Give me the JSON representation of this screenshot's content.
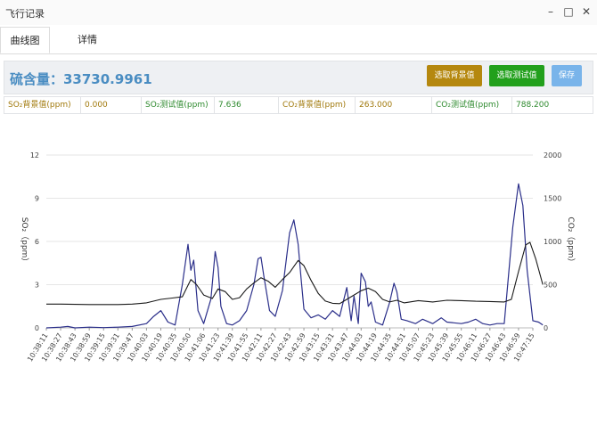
{
  "window": {
    "title": "飞行记录"
  },
  "tabs": [
    {
      "label": "曲线图"
    },
    {
      "label": "详情"
    }
  ],
  "summary": {
    "label": "硫含量：33730.9961"
  },
  "buttons": {
    "select_bg": "选取背景值",
    "select_test": "选取测试值",
    "save": "保存"
  },
  "readings": {
    "so2_bg_label": "SO₂背景值(ppm)",
    "so2_bg_value": "0.000",
    "so2_test_label": "SO₂测试值(ppm)",
    "so2_test_value": "7.636",
    "co2_bg_label": "CO₂背景值(ppm)",
    "co2_bg_value": "263.000",
    "co2_test_label": "CO₂测试值(ppm)",
    "co2_test_value": "788.200"
  },
  "colors": {
    "so2": "#2b2f8a",
    "co2": "#1a1a1a",
    "grid": "#e6e6e6"
  },
  "chart_data": {
    "type": "line",
    "ylabel_left": "SO₂（ppm）",
    "ylabel_right": "CO₂（ppm）",
    "left_ticks": [
      "0",
      "3",
      "6",
      "9",
      "12"
    ],
    "right_ticks": [
      "0",
      "500",
      "1000",
      "1500",
      "2000"
    ],
    "ylim_left": [
      0,
      12
    ],
    "ylim_right": [
      0,
      2000
    ],
    "x_ticks": [
      "10:38:11",
      "10:38:27",
      "10:38:43",
      "10:38:59",
      "10:39:15",
      "10:39:31",
      "10:39:47",
      "10:40:03",
      "10:40:19",
      "10:40:35",
      "10:40:50",
      "10:41:06",
      "10:41:23",
      "10:41:39",
      "10:41:55",
      "10:42:11",
      "10:42:27",
      "10:42:43",
      "10:42:59",
      "10:43:15",
      "10:43:31",
      "10:43:47",
      "10:44:03",
      "10:44:19",
      "10:44:35",
      "10:44:51",
      "10:45:07",
      "10:45:23",
      "10:45:39",
      "10:45:55",
      "10:46:11",
      "10:46:27",
      "10:46:43",
      "10:46:59",
      "10:47:15"
    ],
    "series": [
      {
        "axis": "left",
        "points": [
          [
            0,
            0
          ],
          [
            1,
            0.05
          ],
          [
            1.5,
            0.1
          ],
          [
            2,
            0
          ],
          [
            3,
            0.05
          ],
          [
            4,
            0.02
          ],
          [
            5,
            0.05
          ],
          [
            6,
            0.1
          ],
          [
            7,
            0.3
          ],
          [
            7.5,
            0.8
          ],
          [
            8,
            1.2
          ],
          [
            8.5,
            0.4
          ],
          [
            9,
            0.2
          ],
          [
            9.5,
            3
          ],
          [
            9.9,
            5.8
          ],
          [
            10.1,
            4
          ],
          [
            10.3,
            4.7
          ],
          [
            10.6,
            1.2
          ],
          [
            11,
            0.3
          ],
          [
            11.5,
            2
          ],
          [
            11.8,
            5.3
          ],
          [
            12,
            4.2
          ],
          [
            12.2,
            1.5
          ],
          [
            12.6,
            0.3
          ],
          [
            13,
            0.2
          ],
          [
            13.5,
            0.5
          ],
          [
            14,
            1.2
          ],
          [
            14.5,
            3
          ],
          [
            14.8,
            4.8
          ],
          [
            15,
            4.9
          ],
          [
            15.2,
            3.6
          ],
          [
            15.6,
            1.2
          ],
          [
            16,
            0.8
          ],
          [
            16.5,
            2.6
          ],
          [
            17,
            6.6
          ],
          [
            17.3,
            7.5
          ],
          [
            17.6,
            5.8
          ],
          [
            17.8,
            3.5
          ],
          [
            18,
            1.3
          ],
          [
            18.5,
            0.7
          ],
          [
            19,
            0.9
          ],
          [
            19.5,
            0.6
          ],
          [
            20,
            1.2
          ],
          [
            20.5,
            0.8
          ],
          [
            21,
            2.8
          ],
          [
            21.3,
            0.5
          ],
          [
            21.5,
            2.2
          ],
          [
            21.8,
            0.3
          ],
          [
            22,
            3.8
          ],
          [
            22.3,
            3.2
          ],
          [
            22.5,
            1.5
          ],
          [
            22.7,
            1.8
          ],
          [
            23,
            0.4
          ],
          [
            23.5,
            0.2
          ],
          [
            24,
            1.8
          ],
          [
            24.3,
            3.1
          ],
          [
            24.5,
            2.5
          ],
          [
            24.8,
            0.6
          ],
          [
            25.2,
            0.5
          ],
          [
            25.8,
            0.3
          ],
          [
            26.3,
            0.6
          ],
          [
            27,
            0.3
          ],
          [
            27.6,
            0.7
          ],
          [
            28,
            0.4
          ],
          [
            29,
            0.3
          ],
          [
            29.5,
            0.4
          ],
          [
            30,
            0.6
          ],
          [
            30.5,
            0.3
          ],
          [
            31,
            0.2
          ],
          [
            31.5,
            0.3
          ],
          [
            32,
            0.3
          ],
          [
            32.6,
            7
          ],
          [
            33,
            10
          ],
          [
            33.3,
            8.5
          ],
          [
            33.6,
            4
          ],
          [
            34,
            0.5
          ],
          [
            34.4,
            0.4
          ],
          [
            34.7,
            0.2
          ]
        ]
      },
      {
        "axis": "right",
        "points": [
          [
            0,
            275
          ],
          [
            1,
            275
          ],
          [
            2,
            272
          ],
          [
            3,
            270
          ],
          [
            4,
            270
          ],
          [
            5,
            270
          ],
          [
            6,
            275
          ],
          [
            7,
            290
          ],
          [
            8,
            330
          ],
          [
            8.8,
            345
          ],
          [
            9.5,
            360
          ],
          [
            10.1,
            560
          ],
          [
            10.5,
            500
          ],
          [
            11,
            380
          ],
          [
            11.6,
            340
          ],
          [
            12,
            450
          ],
          [
            12.5,
            420
          ],
          [
            13,
            330
          ],
          [
            13.5,
            350
          ],
          [
            14,
            450
          ],
          [
            14.5,
            520
          ],
          [
            15,
            580
          ],
          [
            15.5,
            540
          ],
          [
            16,
            470
          ],
          [
            16.5,
            560
          ],
          [
            17,
            640
          ],
          [
            17.6,
            780
          ],
          [
            18,
            720
          ],
          [
            18.5,
            550
          ],
          [
            19,
            400
          ],
          [
            19.5,
            310
          ],
          [
            20,
            285
          ],
          [
            20.5,
            280
          ],
          [
            21,
            330
          ],
          [
            21.5,
            380
          ],
          [
            22,
            430
          ],
          [
            22.5,
            460
          ],
          [
            23,
            420
          ],
          [
            23.5,
            330
          ],
          [
            24,
            300
          ],
          [
            24.5,
            320
          ],
          [
            25,
            290
          ],
          [
            26,
            315
          ],
          [
            27,
            300
          ],
          [
            28,
            320
          ],
          [
            29,
            315
          ],
          [
            30,
            308
          ],
          [
            31,
            305
          ],
          [
            32,
            300
          ],
          [
            32.5,
            330
          ],
          [
            33,
            650
          ],
          [
            33.5,
            960
          ],
          [
            33.8,
            990
          ],
          [
            34.2,
            800
          ],
          [
            34.7,
            500
          ]
        ]
      }
    ]
  }
}
